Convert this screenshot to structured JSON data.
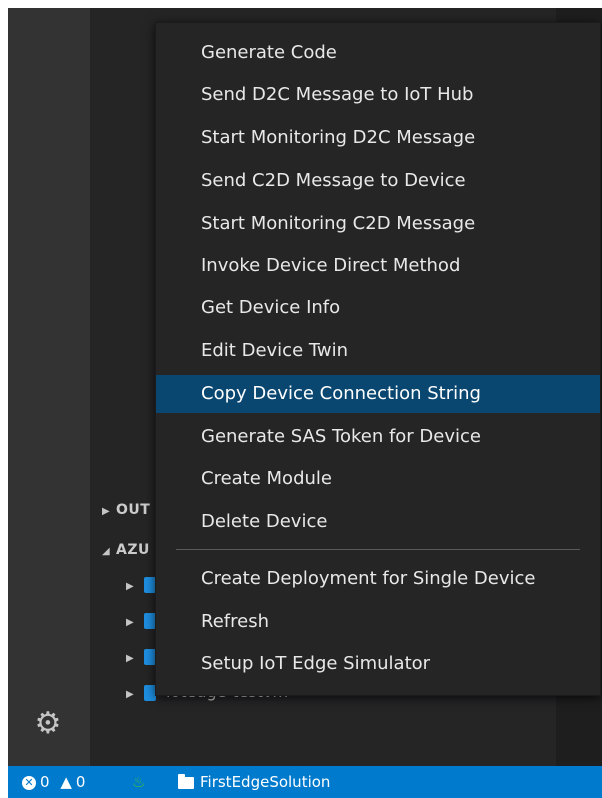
{
  "context_menu": {
    "items": [
      {
        "label": "Generate Code"
      },
      {
        "label": "Send D2C Message to IoT Hub"
      },
      {
        "label": "Start Monitoring D2C Message"
      },
      {
        "label": "Send C2D Message to Device"
      },
      {
        "label": "Start Monitoring C2D Message"
      },
      {
        "label": "Invoke Device Direct Method"
      },
      {
        "label": "Get Device Info"
      },
      {
        "label": "Edit Device Twin"
      },
      {
        "label": "Copy Device Connection String",
        "selected": true
      },
      {
        "label": "Generate SAS Token for Device"
      },
      {
        "label": "Create Module"
      },
      {
        "label": "Delete Device"
      },
      {
        "label": "Create Deployment for Single Device"
      },
      {
        "label": "Refresh"
      },
      {
        "label": "Setup IoT Edge Simulator"
      }
    ],
    "highlight_color": "#094771"
  },
  "sidebar": {
    "sections": [
      {
        "label": "OUT",
        "expanded": false
      },
      {
        "label": "AZU",
        "expanded": true
      }
    ],
    "device_fragment": "ioteuge-testvm"
  },
  "status_bar": {
    "errors": "0",
    "warnings": "0",
    "folder": "FirstEdgeSolution",
    "background_color": "#007acc"
  },
  "icons": [
    "gear-icon",
    "error-icon",
    "warning-icon",
    "flame-icon",
    "folder-icon",
    "device-icon",
    "chevron-right-icon",
    "chevron-down-icon"
  ]
}
